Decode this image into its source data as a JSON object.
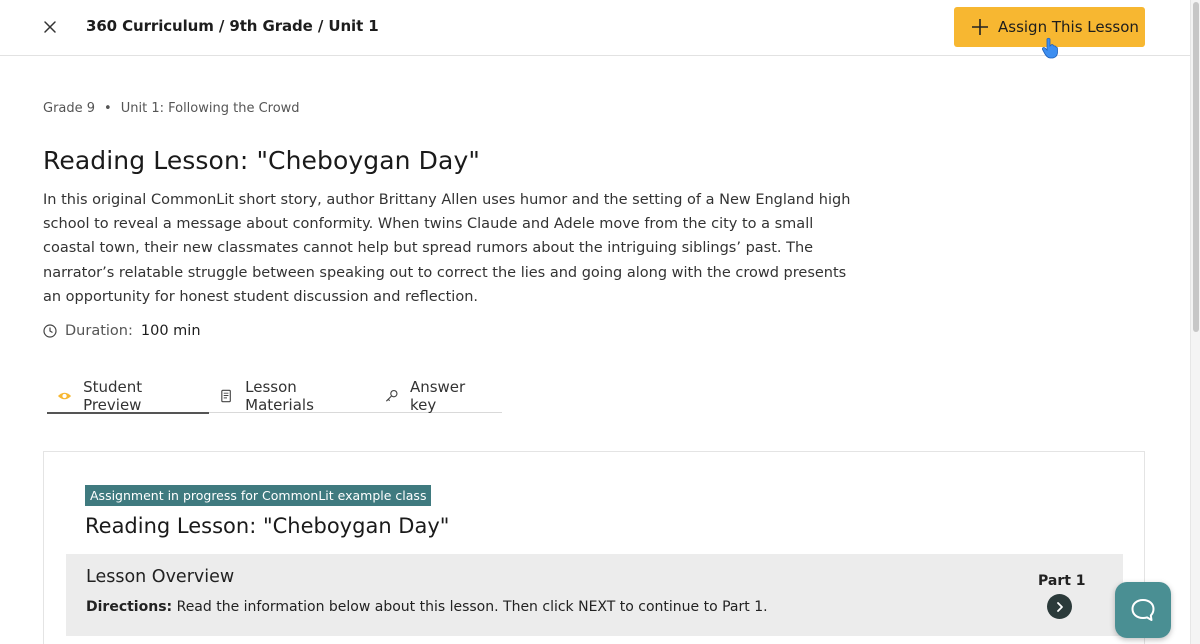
{
  "header": {
    "breadcrumb": "360 Curriculum / 9th Grade / Unit 1",
    "assign_label": "Assign This Lesson",
    "close_icon": "close-icon",
    "assign_color": "#f7b731"
  },
  "meta": {
    "grade": "Grade 9",
    "separator": "•",
    "unit": "Unit 1: Following the Crowd"
  },
  "lesson": {
    "title": "Reading Lesson: \"Cheboygan Day\"",
    "description": "In this original CommonLit short story, author Brittany Allen uses humor and the setting of a New England high school to reveal a message about conformity. When twins Claude and Adele move from the city to a small coastal town, their new classmates cannot help but spread rumors about the intriguing siblings’ past. The narrator’s relatable struggle between speaking out to correct the lies and going along with the crowd presents an opportunity for honest student discussion and reflection.",
    "duration_label": "Duration:",
    "duration_value": "100 min"
  },
  "tabs": [
    {
      "label": "Student Preview",
      "icon": "eye-icon",
      "active": true
    },
    {
      "label": "Lesson Materials",
      "icon": "document-icon",
      "active": false
    },
    {
      "label": "Answer key",
      "icon": "key-icon",
      "active": false
    }
  ],
  "preview": {
    "badge": "Assignment in progress for CommonLit example class",
    "badge_color": "#3f7a7f",
    "title": "Reading Lesson: \"Cheboygan Day\"",
    "overview_title": "Lesson Overview",
    "directions_label": "Directions:",
    "directions_text": "Read the information below about this lesson. Then click NEXT to continue to Part 1.",
    "part_label": "Part 1"
  },
  "chat": {
    "icon": "chat-bubble-icon",
    "color": "#4a8f93"
  }
}
